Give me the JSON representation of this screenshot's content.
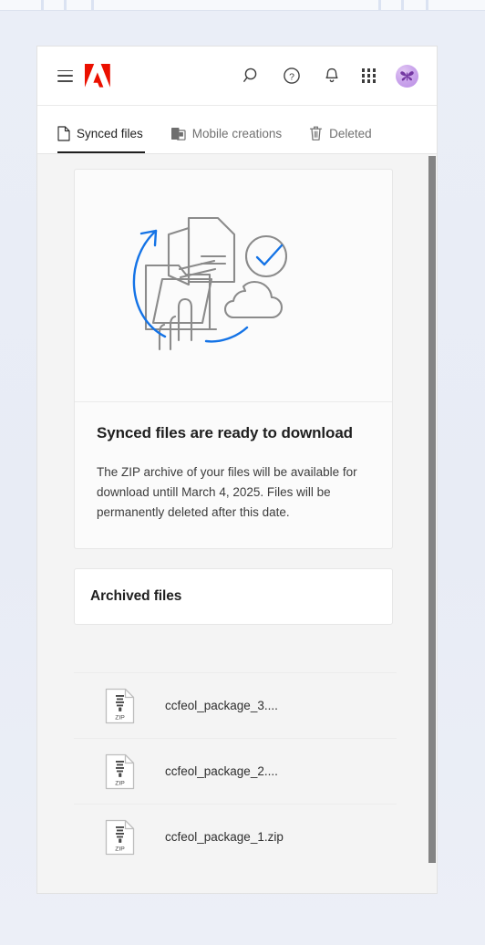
{
  "window": {
    "brand_color": "#EB1000",
    "accent_color": "#1473E6"
  },
  "header": {
    "menu_label": "Menu",
    "logo_name": "Adobe",
    "actions": [
      {
        "name": "search-icon",
        "label": "Search"
      },
      {
        "name": "help-icon",
        "label": "Help"
      },
      {
        "name": "notifications-icon",
        "label": "Notifications"
      },
      {
        "name": "app-switcher-icon",
        "label": "Apps"
      },
      {
        "name": "avatar",
        "label": "Account"
      }
    ]
  },
  "tabs": [
    {
      "label": "Synced files",
      "icon": "document-icon",
      "active": true
    },
    {
      "label": "Mobile creations",
      "icon": "mobile-device-icon",
      "active": false
    },
    {
      "label": "Deleted",
      "icon": "trash-icon",
      "active": false
    }
  ],
  "info_card": {
    "illustration_name": "synced-files-ready-illustration",
    "title": "Synced files are ready to download",
    "body": "The ZIP archive of your files will be available for download untill March 4, 2025. Files will be permanently deleted after this date."
  },
  "archived_section": {
    "title": "Archived files"
  },
  "files": [
    {
      "name": "ccfeol_package_3....",
      "type": "ZIP"
    },
    {
      "name": "ccfeol_package_2....",
      "type": "ZIP"
    },
    {
      "name": "ccfeol_package_1.zip",
      "type": "ZIP"
    }
  ],
  "scrollbar": {
    "name": "vertical-scrollbar"
  }
}
